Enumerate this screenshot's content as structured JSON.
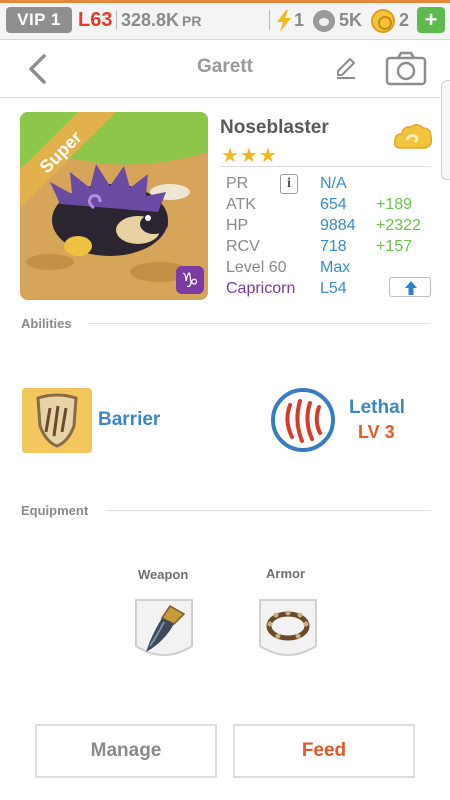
{
  "status": {
    "vip": "VIP 1",
    "level": "L63",
    "pr_value": "328.8K",
    "pr_unit": "PR",
    "energy": "1",
    "paws": "5K",
    "coins": "2",
    "plus": "+"
  },
  "header": {
    "title": "Garett"
  },
  "pet": {
    "rarity": "Super",
    "name": "Noseblaster",
    "stars": "★★★",
    "stats": [
      {
        "key": "PR",
        "value": "N/A",
        "bonus": ""
      },
      {
        "key": "ATK",
        "value": "654",
        "bonus": "+189"
      },
      {
        "key": "HP",
        "value": "9884",
        "bonus": "+2322"
      },
      {
        "key": "RCV",
        "value": "718",
        "bonus": "+157"
      },
      {
        "key": "Level 60",
        "value": "Max",
        "bonus": ""
      },
      {
        "key": "Capricorn",
        "value": "L54",
        "bonus": ""
      }
    ],
    "info_glyph": "i",
    "zodiac_glyph": "♑"
  },
  "abilities": {
    "title": "Abilities",
    "items": [
      {
        "name": "Barrier",
        "level": ""
      },
      {
        "name": "Lethal",
        "level": "LV 3"
      }
    ]
  },
  "equipment": {
    "title": "Equipment",
    "weapon_label": "Weapon",
    "armor_label": "Armor"
  },
  "actions": {
    "manage": "Manage",
    "feed": "Feed"
  },
  "colors": {
    "accent_blue": "#3d87c3",
    "bonus_green": "#6cc24a",
    "feed_orange": "#e4572a",
    "level_red": "#e33b2a",
    "star_gold": "#f2b81b"
  }
}
